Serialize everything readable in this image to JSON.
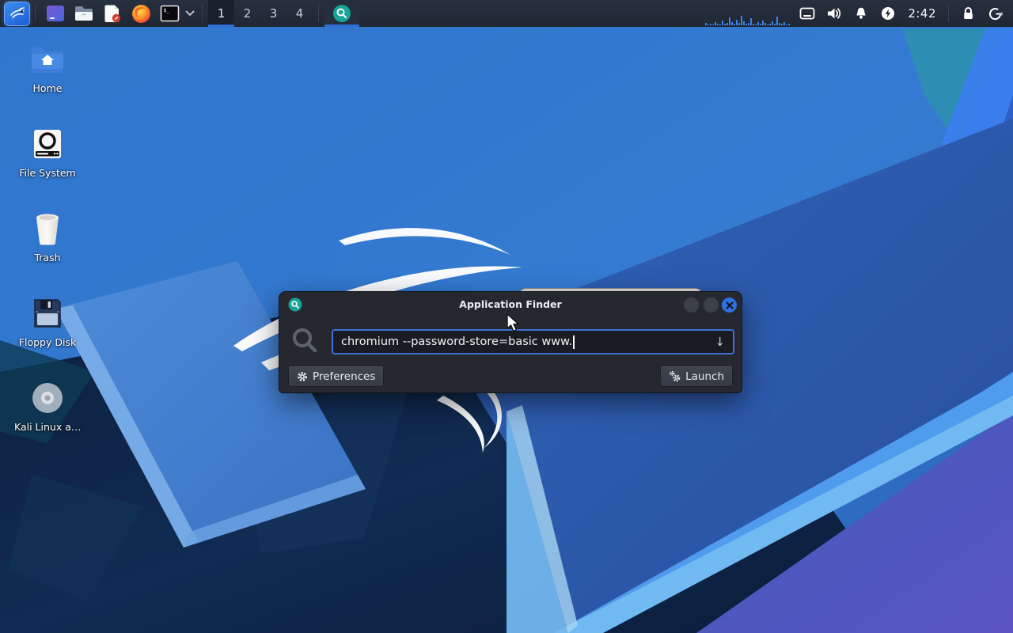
{
  "panel": {
    "workspaces": {
      "items": [
        "1",
        "2",
        "3",
        "4"
      ],
      "active": "1"
    },
    "clock": "2:42",
    "cpu_bars": [
      3,
      1,
      2,
      1,
      4,
      2,
      1,
      6,
      2,
      3,
      10,
      4,
      2,
      7,
      3,
      12,
      5,
      2,
      3,
      9,
      2,
      1,
      4,
      2,
      6,
      3,
      1,
      2,
      5,
      2,
      11,
      3,
      2,
      4,
      1,
      2
    ],
    "launcher_icons": [
      "kali-menu-icon",
      "desktop-icon",
      "file-manager-icon",
      "text-editor-icon",
      "firefox-icon",
      "terminal-icon",
      "chevron-down-icon"
    ],
    "taskbar_app_icon": "app-finder-icon",
    "tray_icons": [
      "cpu-graph",
      "touchpad-icon",
      "volume-icon",
      "notifications-icon",
      "power-manager-icon",
      "lock-icon",
      "logout-icon"
    ],
    "terminal_glyph": "$_"
  },
  "desktop": {
    "icons": [
      {
        "label": "Home",
        "icon": "home-folder-icon"
      },
      {
        "label": "File System",
        "icon": "hard-drive-icon"
      },
      {
        "label": "Trash",
        "icon": "trash-icon"
      },
      {
        "label": "Floppy Disk",
        "icon": "floppy-disk-icon"
      },
      {
        "label": "Kali Linux a…",
        "icon": "cd-disc-icon"
      }
    ]
  },
  "finder_window": {
    "title": "Application Finder",
    "search_value": "chromium --password-store=basic www.",
    "dropdown_glyph": "↓",
    "preferences_label": "Preferences",
    "launch_label": "Launch",
    "controls": [
      "minimize",
      "maximize",
      "close"
    ]
  },
  "colors": {
    "accent_blue": "#3f71d8",
    "panel_bg": "#222a36",
    "window_bg": "#25292f",
    "input_bg": "#191c21",
    "close_button_blue": "#2e6fe2",
    "finder_teal": "#17a398",
    "cpu_bar_blue": "#3f84e8",
    "wallpaper_base": "#2f72c8"
  }
}
